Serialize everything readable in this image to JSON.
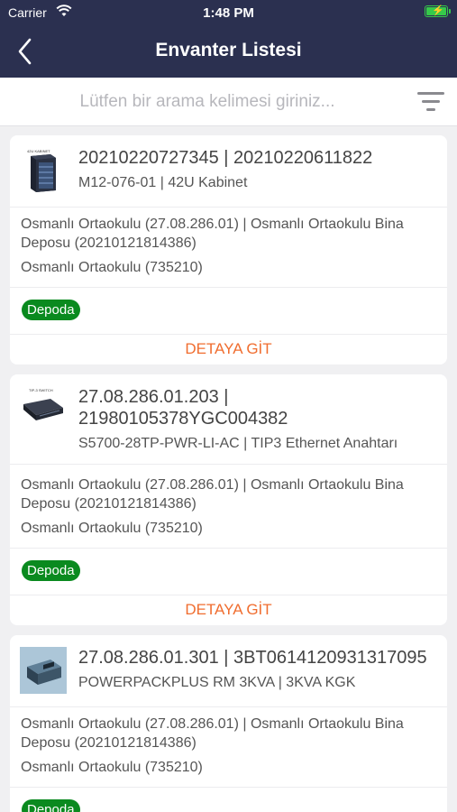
{
  "status_bar": {
    "carrier": "Carrier",
    "time": "1:48 PM",
    "wifi_icon": "wifi-icon",
    "battery_icon": "battery-charging-icon"
  },
  "nav": {
    "title": "Envanter Listesi",
    "back_icon": "chevron-left-icon"
  },
  "search": {
    "placeholder": "Lütfen bir arama kelimesi giriniz...",
    "filter_icon": "filter-icon"
  },
  "colors": {
    "nav_bg": "#2b3050",
    "badge_green": "#0a8a1f",
    "detail_orange": "#f06d2f"
  },
  "items": [
    {
      "title": "20210220727345 | 20210220611822",
      "subtitle": "M12-076-01 | 42U Kabinet",
      "location": "Osmanlı Ortaokulu  (27.08.286.01) | Osmanlı Ortaokulu  Bina Deposu (20210121814386)",
      "school": "Osmanlı Ortaokulu (735210)",
      "status": "Depoda",
      "detail": "DETAYA GİT",
      "thumb_label": "42U KABINET",
      "icon": "server-cabinet-icon"
    },
    {
      "title": "27.08.286.01.203 | 21980105378YGC004382",
      "subtitle": "S5700-28TP-PWR-LI-AC | TIP3 Ethernet Anahtarı",
      "location": "Osmanlı Ortaokulu  (27.08.286.01) | Osmanlı Ortaokulu  Bina Deposu (20210121814386)",
      "school": "Osmanlı Ortaokulu (735210)",
      "status": "Depoda",
      "detail": "DETAYA GİT",
      "thumb_label": "TIP-3 SWITCH",
      "icon": "network-switch-icon"
    },
    {
      "title": "27.08.286.01.301 | 3BT0614120931317095",
      "subtitle": "POWERPACKPLUS RM 3KVA | 3KVA KGK",
      "location": "Osmanlı Ortaokulu  (27.08.286.01) | Osmanlı Ortaokulu  Bina Deposu (20210121814386)",
      "school": "Osmanlı Ortaokulu (735210)",
      "status": "Depoda",
      "icon": "ups-device-icon"
    }
  ]
}
